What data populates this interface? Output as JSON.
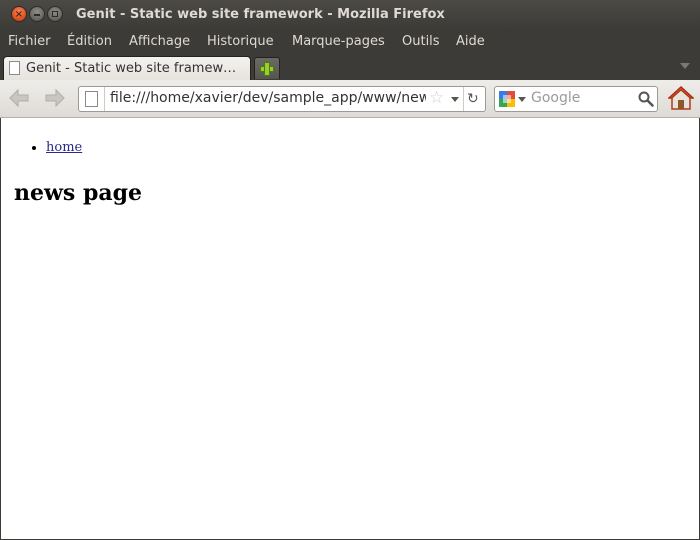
{
  "window": {
    "title": "Genit - Static web site framework - Mozilla Firefox"
  },
  "menubar": {
    "items": [
      "Fichier",
      "Édition",
      "Affichage",
      "Historique",
      "Marque-pages",
      "Outils",
      "Aide"
    ]
  },
  "tabs": [
    {
      "label": "Genit - Static web site framew…",
      "active": true
    }
  ],
  "navbar": {
    "url": "file:///home/xavier/dev/sample_app/www/news.html",
    "search_placeholder": "Google"
  },
  "page": {
    "links": [
      "home"
    ],
    "heading": "news page"
  },
  "icons": {
    "window_controls": [
      "close-icon",
      "minimize-icon",
      "maximize-icon"
    ],
    "navigation": [
      "back-icon",
      "forward-icon",
      "page-icon",
      "bookmark-star-icon",
      "dropdown-icon",
      "reload-icon",
      "google-icon",
      "magnifier-icon",
      "home-icon",
      "new-tab-icon"
    ]
  },
  "colors": {
    "title_bar": "#3c3b37",
    "close_button": "#e0531f",
    "link": "#2a2a8c"
  }
}
